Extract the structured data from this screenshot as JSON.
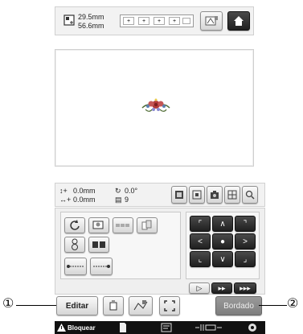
{
  "top": {
    "width": "29.5mm",
    "height": "56.6mm",
    "scale_buttons": [
      "+",
      "+",
      "+",
      "+"
    ],
    "home_icon": "home-icon",
    "thread_icon": "thread-spool-icon"
  },
  "status": {
    "x_move": "0.0mm",
    "y_move": "0.0mm",
    "angle": "0.0°",
    "colors": "9"
  },
  "edit_button_label": "Editar",
  "bordado_button_label": "Bordado",
  "callouts": [
    "①",
    "②"
  ],
  "bottom_bar": {
    "lock_label": "Bloquear"
  },
  "colors": {
    "accent_home": "#2b2b2b",
    "background": "#ffffff",
    "panel": "#f0f0f0",
    "bottom_bar": "#111111"
  }
}
